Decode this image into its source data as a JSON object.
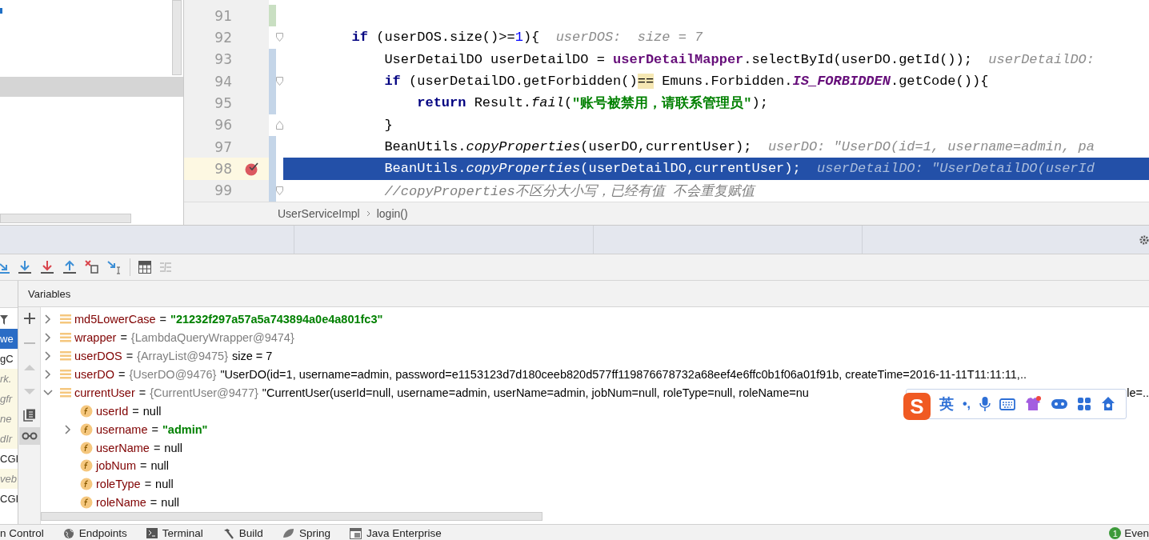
{
  "editor": {
    "lines": [
      {
        "number": "91",
        "selected": false,
        "breakpoint": false,
        "color": "#c9dfc2",
        "fold_start": false,
        "fold_end": false
      },
      {
        "number": "92",
        "selected": false,
        "breakpoint": false,
        "fold_start": true,
        "fold_end": false,
        "tokens": [
          {
            "kind": "keyword",
            "text": "        if"
          },
          {
            "kind": "plain",
            "text": " (userDOS.size()>="
          },
          {
            "kind": "number",
            "text": "1"
          },
          {
            "kind": "plain",
            "text": "){"
          },
          {
            "kind": "hint",
            "text": "userDOS:  size = 7"
          }
        ]
      },
      {
        "number": "93",
        "selected": false,
        "breakpoint": false,
        "color": "#c4d5e8",
        "fold_start": false,
        "fold_end": false,
        "tokens": [
          {
            "kind": "plain",
            "text": "            UserDetailDO userDetailDO = "
          },
          {
            "kind": "field",
            "text": "userDetailMapper"
          },
          {
            "kind": "plain",
            "text": ".selectById(userDO.getId());"
          },
          {
            "kind": "hint",
            "text": "userDetailDO:"
          }
        ]
      },
      {
        "number": "94",
        "selected": false,
        "breakpoint": false,
        "color": "#c4d5e8",
        "fold_start": true,
        "fold_end": false,
        "tokens": [
          {
            "kind": "keyword",
            "text": "            if"
          },
          {
            "kind": "plain",
            "text": " (userDetailDO.getForbidden()"
          },
          {
            "kind": "match",
            "text": "=="
          },
          {
            "kind": "plain",
            "text": " Emuns.Forbidden."
          },
          {
            "kind": "constant",
            "text": "IS_FORBIDDEN"
          },
          {
            "kind": "plain",
            "text": ".getCode()){"
          }
        ]
      },
      {
        "number": "95",
        "selected": false,
        "breakpoint": false,
        "color": "#c4d5e8",
        "fold_start": false,
        "fold_end": false,
        "tokens": [
          {
            "kind": "keyword",
            "text": "                return"
          },
          {
            "kind": "plain",
            "text": " Result."
          },
          {
            "kind": "static",
            "text": "fail"
          },
          {
            "kind": "plain",
            "text": "("
          },
          {
            "kind": "string",
            "text": "\"账号被禁用，请联系管理员\""
          },
          {
            "kind": "plain",
            "text": ");"
          }
        ]
      },
      {
        "number": "96",
        "selected": false,
        "breakpoint": false,
        "fold_start": false,
        "fold_end": true,
        "tokens": [
          {
            "kind": "plain",
            "text": "            }"
          }
        ]
      },
      {
        "number": "97",
        "selected": false,
        "breakpoint": false,
        "color": "#c4d5e8",
        "fold_start": false,
        "fold_end": false,
        "tokens": [
          {
            "kind": "plain",
            "text": "            BeanUtils."
          },
          {
            "kind": "static",
            "text": "copyProperties"
          },
          {
            "kind": "plain",
            "text": "(userDO,currentUser);"
          },
          {
            "kind": "hint",
            "text": "userDO: \"UserDO(id=1, username=admin, pa"
          }
        ]
      },
      {
        "number": "98",
        "selected": true,
        "breakpoint": true,
        "color": "#c4d5e8",
        "fold_start": false,
        "fold_end": false,
        "tokens": [
          {
            "kind": "plain",
            "text": "            BeanUtils."
          },
          {
            "kind": "static",
            "text": "copyProperties"
          },
          {
            "kind": "plain",
            "text": "(userDetailDO,currentUser);"
          },
          {
            "kind": "hint",
            "text": "userDetailDO: \"UserDetailDO(userId"
          }
        ]
      },
      {
        "number": "99",
        "selected": false,
        "breakpoint": false,
        "color": "#c4d5e8",
        "fold_start": true,
        "fold_end": false,
        "tokens": [
          {
            "kind": "comment",
            "text": "            //copyProperties不区分大小写，已经有值 不会重复赋值"
          }
        ]
      }
    ],
    "breadcrumbs": [
      "UserServiceImpl",
      "login()"
    ]
  },
  "debugger": {
    "variables_title": "Variables",
    "frames": [
      {
        "text": "we",
        "kind": "app",
        "selected": true
      },
      {
        "text": "gC",
        "kind": "app",
        "selected": false
      },
      {
        "text": "rk.",
        "kind": "library",
        "selected": false
      },
      {
        "text": "gfr",
        "kind": "library",
        "selected": false
      },
      {
        "text": "ne",
        "kind": "library",
        "selected": false
      },
      {
        "text": "dIr",
        "kind": "library",
        "selected": false
      },
      {
        "text": "CGI",
        "kind": "app",
        "selected": false
      },
      {
        "text": "veb",
        "kind": "library",
        "selected": false
      },
      {
        "text": "CGI",
        "kind": "app",
        "selected": false
      }
    ],
    "variables": [
      {
        "name": "md5LowerCase",
        "kind": "local",
        "expandable": true,
        "expanded": false,
        "operator": "=",
        "value": "\"21232f297a57a5a743894a0e4a801fc3\"",
        "string_value": true
      },
      {
        "name": "wrapper",
        "kind": "local",
        "expandable": true,
        "expanded": false,
        "operator": "=",
        "type_ref": "{LambdaQueryWrapper@9474}"
      },
      {
        "name": "userDOS",
        "kind": "local",
        "expandable": true,
        "expanded": false,
        "operator": "=",
        "type_ref": "{ArrayList@9475}",
        "value": "size = 7",
        "string_value": false
      },
      {
        "name": "userDO",
        "kind": "local",
        "expandable": true,
        "expanded": false,
        "operator": "=",
        "type_ref": "{UserDO@9476}",
        "value": "\"UserDO(id=1, username=admin, password=e1153123d7d180ceeb820d577ff119876678732a68eef4e6ffc0b1f06a01f91b, createTime=2016-11-11T11:11:11,..",
        "string_value": false
      },
      {
        "name": "currentUser",
        "kind": "local",
        "expandable": true,
        "expanded": true,
        "operator": "=",
        "type_ref": "{CurrentUser@9477}",
        "value": "\"CurrentUser(userId=null, username=admin, userName=admin, jobNum=null, roleType=null, roleName=nu",
        "string_value": false,
        "value_tail": "le=..",
        "children": [
          {
            "name": "userId",
            "kind": "field",
            "expandable": false,
            "operator": "=",
            "value": "null",
            "string_value": false
          },
          {
            "name": "username",
            "kind": "field",
            "expandable": true,
            "expanded": false,
            "operator": "=",
            "value": "\"admin\"",
            "string_value": true
          },
          {
            "name": "userName",
            "kind": "field",
            "expandable": false,
            "operator": "=",
            "value": "null",
            "string_value": false
          },
          {
            "name": "jobNum",
            "kind": "field",
            "expandable": false,
            "operator": "=",
            "value": "null",
            "string_value": false
          },
          {
            "name": "roleType",
            "kind": "field",
            "expandable": false,
            "operator": "=",
            "value": "null",
            "string_value": false
          },
          {
            "name": "roleName",
            "kind": "field",
            "expandable": false,
            "operator": "=",
            "value": "null",
            "string_value": false
          }
        ]
      }
    ]
  },
  "ime_toolbar": {
    "logo": "S",
    "mode": "英",
    "punctuation": "•,"
  },
  "tool_windows": [
    "n Control",
    "Endpoints",
    "Terminal",
    "Build",
    "Spring",
    "Java Enterprise"
  ],
  "event_log": {
    "count": "1",
    "label": "Even"
  }
}
